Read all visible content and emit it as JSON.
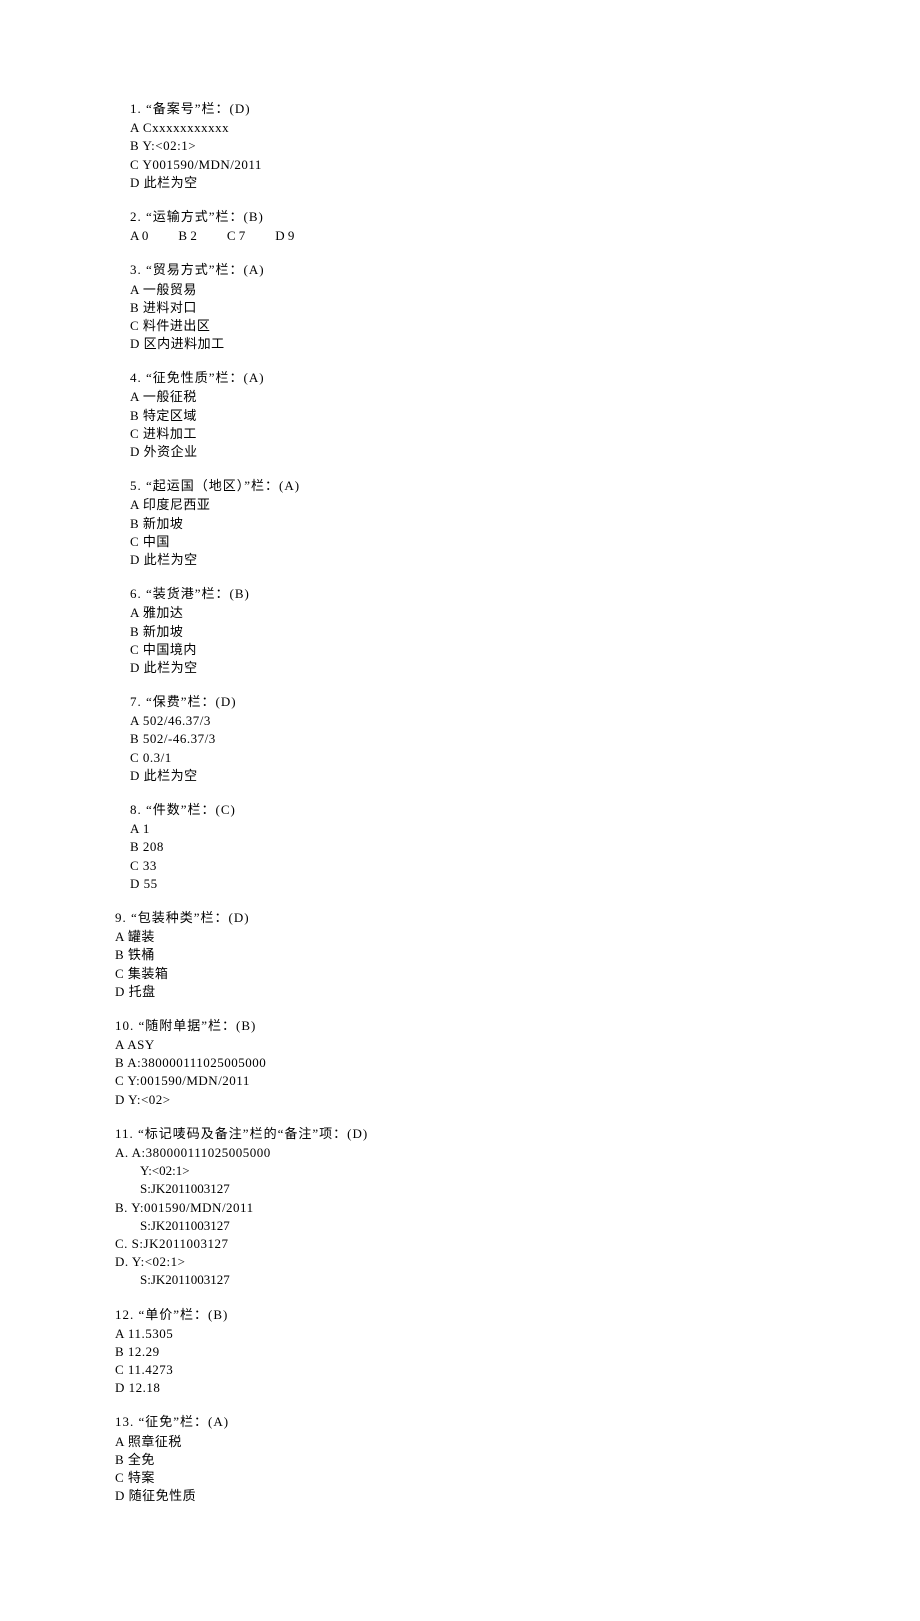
{
  "questions": [
    {
      "num": "1",
      "title": "“备案号”栏：(D)",
      "options": [
        "A  Cxxxxxxxxxxx",
        "B  Y:<02:1>",
        "C  Y001590/MDN/2011",
        "D  此栏为空"
      ]
    },
    {
      "num": "2",
      "title": "“运输方式”栏：(B)",
      "inline_options": [
        "A  0",
        "B  2",
        "C  7",
        "D  9"
      ]
    },
    {
      "num": "3",
      "title": "“贸易方式”栏：(A)",
      "options": [
        "A  一般贸易",
        "B  进料对口",
        "C  料件进出区",
        "D  区内进料加工"
      ]
    },
    {
      "num": "4",
      "title": "“征免性质”栏：(A)",
      "options": [
        "A  一般征税",
        "B  特定区域",
        "C  进料加工",
        "D  外资企业"
      ]
    },
    {
      "num": "5",
      "title": "“起运国（地区）”栏：(A)",
      "options": [
        "A  印度尼西亚",
        "B  新加坡",
        "C  中国",
        "D  此栏为空"
      ]
    },
    {
      "num": "6",
      "title": "“装货港”栏：(B)",
      "options": [
        "A  雅加达",
        "B  新加坡",
        "C  中国境内",
        "D  此栏为空"
      ]
    },
    {
      "num": "7",
      "title": "“保费”栏：(D)",
      "options": [
        "A  502/46.37/3",
        "B  502/-46.37/3",
        "C  0.3/1",
        "D  此栏为空"
      ]
    },
    {
      "num": "8",
      "title": "“件数”栏：(C)",
      "options": [
        "A  1",
        "B  208",
        "C  33",
        "D  55"
      ]
    },
    {
      "num": "9",
      "title": "“包装种类”栏：(D)",
      "options": [
        "A  罐装",
        "B  铁桶",
        "C  集装箱",
        "D  托盘"
      ]
    },
    {
      "num": "10",
      "title": "“随附单据”栏：(B)",
      "options": [
        "A  ASY",
        "B  A:380000111025005000",
        "C  Y:001590/MDN/2011",
        "D  Y:<02>"
      ]
    },
    {
      "num": "11",
      "title": "“标记唛码及备注”栏的“备注”项：(D)",
      "multi_options": [
        {
          "label": "A. A:380000111025005000",
          "subs": [
            "Y:<02:1>",
            "S:JK2011003127"
          ]
        },
        {
          "label": "B. Y:001590/MDN/2011",
          "subs": [
            "S:JK2011003127"
          ]
        },
        {
          "label": "C. S:JK2011003127",
          "subs": []
        },
        {
          "label": "D. Y:<02:1>",
          "subs": [
            "S:JK2011003127"
          ]
        }
      ]
    },
    {
      "num": "12",
      "title": "“单价”栏：(B)",
      "options": [
        "A  11.5305",
        "B  12.29",
        "C  11.4273",
        "D  12.18"
      ]
    },
    {
      "num": "13",
      "title": "“征免”栏：(A)",
      "options": [
        "A  照章征税",
        "B  全免",
        "C  特案",
        "D  随征免性质"
      ]
    }
  ]
}
